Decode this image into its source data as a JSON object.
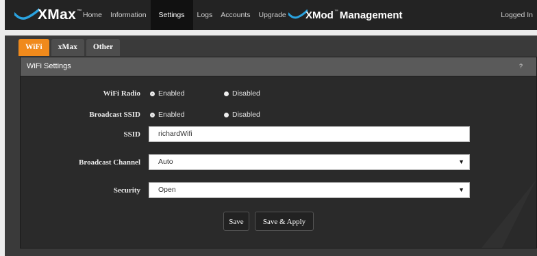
{
  "topbar": {
    "logo": "XMax",
    "logo_mark": "™",
    "nav": [
      "Home",
      "Information",
      "Settings",
      "Logs",
      "Accounts",
      "Upgrade"
    ],
    "active": "Settings",
    "brand2": "XMod",
    "brand2_mark": "™",
    "brand2_suffix": "Management",
    "logged_in": "Logged In"
  },
  "tabs": {
    "wifi": "WiFi",
    "xmax": "xMax",
    "other": "Other"
  },
  "card": {
    "title": "WiFi Settings",
    "help": "?"
  },
  "form": {
    "wifi_radio": {
      "label": "WiFi Radio",
      "opt1": "Enabled",
      "opt2": "Disabled",
      "selected": "Enabled"
    },
    "broadcast_ssid": {
      "label": "Broadcast SSID",
      "opt1": "Enabled",
      "opt2": "Disabled",
      "selected": "Enabled"
    },
    "ssid": {
      "label": "SSID",
      "value": "richardWifi"
    },
    "channel": {
      "label": "Broadcast Channel",
      "value": "Auto"
    },
    "security": {
      "label": "Security",
      "value": "Open"
    }
  },
  "buttons": {
    "save": "Save",
    "save_apply": "Save & Apply"
  },
  "colors": {
    "accent": "#f08a1c",
    "logo_swoosh": "#2aa3e0"
  }
}
